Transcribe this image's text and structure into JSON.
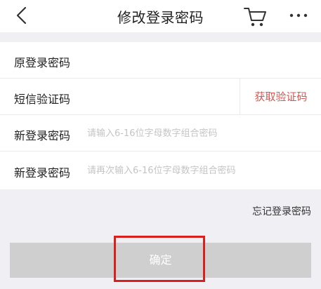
{
  "header": {
    "title": "修改登录密码",
    "back_icon": "chevron-left-icon",
    "cart_icon": "cart-icon",
    "more_icon": "more-dots-icon"
  },
  "form": {
    "rows": [
      {
        "label": "原登录密码",
        "value": "",
        "placeholder": ""
      },
      {
        "label": "短信验证码",
        "value": "",
        "placeholder": "",
        "action_label": "获取验证码"
      },
      {
        "label": "新登录密码",
        "value": "",
        "placeholder": "请输入6-16位字母数字组合密码"
      },
      {
        "label": "新登录密码",
        "value": "",
        "placeholder": "请再次输入6-16位字母数字组合密码"
      }
    ]
  },
  "forgot_label": "忘记登录密码",
  "confirm_label": "确定",
  "colors": {
    "accent": "#e0534f",
    "button_disabled": "#cfcfcf",
    "background": "#efeff4",
    "highlight": "#d9201f"
  }
}
